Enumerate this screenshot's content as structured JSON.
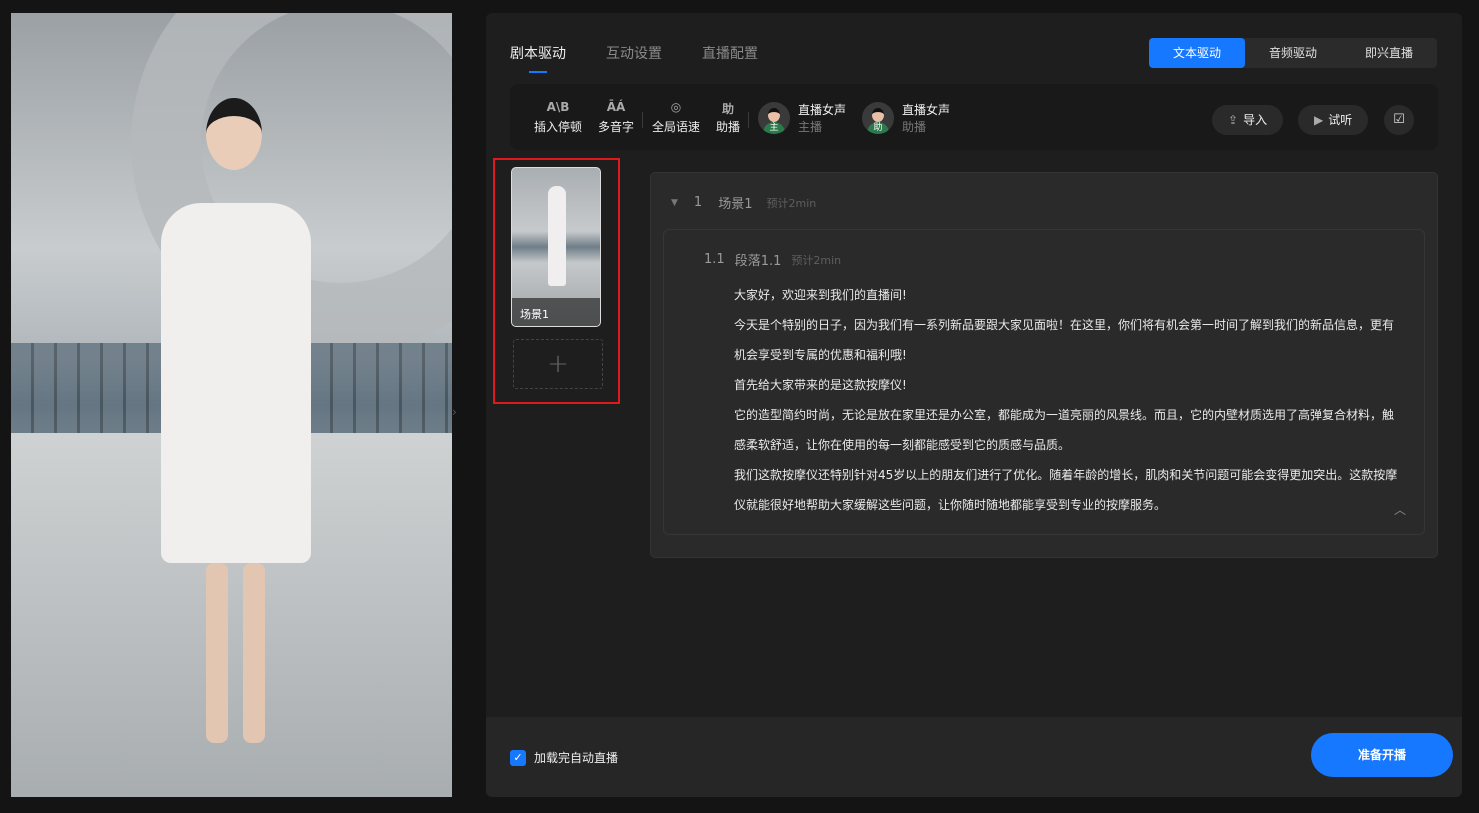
{
  "tabs": [
    "剧本驱动",
    "互动设置",
    "直播配置"
  ],
  "modes": [
    "文本驱动",
    "音频驱动",
    "即兴直播"
  ],
  "tools": [
    {
      "icon": "A\\B",
      "label": "插入停顿"
    },
    {
      "icon": "ĀÁ",
      "label": "多音字"
    },
    {
      "icon": "◎",
      "label": "全局语速"
    },
    {
      "icon": "助",
      "label": "助播"
    }
  ],
  "voices": [
    {
      "badge": "主",
      "name": "直播女声",
      "role": "主播"
    },
    {
      "badge": "助",
      "name": "直播女声",
      "role": "助播"
    }
  ],
  "actions": {
    "import": "导入",
    "listen": "试听"
  },
  "scene_thumb": {
    "label": "场景1",
    "add": "+"
  },
  "scene": {
    "index": "1",
    "name": "场景1",
    "estimate": "预计2min"
  },
  "paragraph": {
    "index": "1.1",
    "name": "段落1.1",
    "estimate": "预计2min",
    "lines": [
      "大家好，欢迎来到我们的直播间!",
      "今天是个特别的日子，因为我们有一系列新品要跟大家见面啦！在这里，你们将有机会第一时间了解到我们的新品信息，更有机会享受到专属的优惠和福利哦!",
      "首先给大家带来的是这款按摩仪!",
      "它的造型简约时尚，无论是放在家里还是办公室，都能成为一道亮丽的风景线。而且，它的内壁材质选用了高弹复合材料，触感柔软舒适，让你在使用的每一刻都能感受到它的质感与品质。",
      "我们这款按摩仪还特别针对45岁以上的朋友们进行了优化。随着年龄的增长，肌肉和关节问题可能会变得更加突出。这款按摩仪就能很好地帮助大家缓解这些问题，让你随时随地都能享受到专业的按摩服务。"
    ]
  },
  "bottom": {
    "auto_label": "加载完自动直播",
    "start": "准备开播"
  }
}
